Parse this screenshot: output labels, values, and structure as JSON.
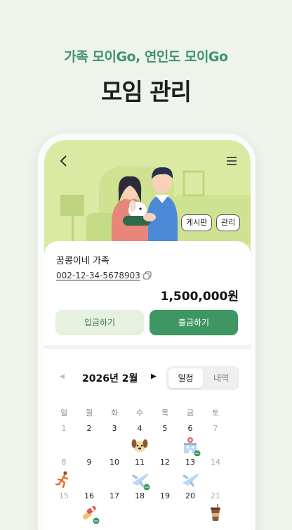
{
  "promo": {
    "subtitle": "가족 모이Go, 연인도 모이Go",
    "title": "모임 관리"
  },
  "header": {
    "back_icon": "back-arrow-icon",
    "menu_icon": "hamburger-menu-icon",
    "board_label": "게시판",
    "manage_label": "관리"
  },
  "group": {
    "name": "꿈콩이네 가족",
    "account_number": "002-12-34-5678903",
    "balance": "1,500,000원",
    "deposit_label": "입금하기",
    "withdraw_label": "출금하기"
  },
  "calendar": {
    "month_label": "2026년 2월",
    "tabs": [
      "일정",
      "내역"
    ],
    "active_tab": "일정",
    "weekdays": [
      "일",
      "월",
      "화",
      "수",
      "목",
      "금",
      "토"
    ],
    "weeks": [
      [
        "1",
        "2",
        "3",
        "4",
        "5",
        "6",
        "7"
      ],
      [
        "8",
        "9",
        "10",
        "11",
        "12",
        "13",
        "14"
      ],
      [
        "15",
        "16",
        "17",
        "18",
        "19",
        "20",
        "21"
      ]
    ],
    "events": [
      {
        "day": "4",
        "icon": "dog-icon"
      },
      {
        "day": "6",
        "icon": "hospital-icon"
      },
      {
        "day": "8",
        "icon": "running-person-icon"
      },
      {
        "day": "11",
        "icon": "airplane-icon"
      },
      {
        "day": "13",
        "icon": "airplane-icon"
      },
      {
        "day": "16",
        "icon": "pills-icon"
      },
      {
        "day": "21",
        "icon": "coffee-cup-icon"
      }
    ]
  },
  "colors": {
    "accent": "#3e9663",
    "hero_bg": "#dbeaa2",
    "page_bg": "#eef3ec"
  }
}
